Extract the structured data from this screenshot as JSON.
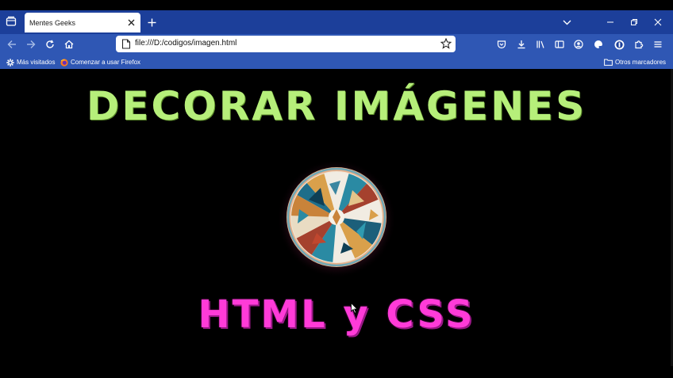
{
  "browser": {
    "tab": {
      "title": "Mentes Geeks"
    },
    "address": {
      "url": "file:///D:/codigos/imagen.html"
    },
    "bookmarks": [
      {
        "label": "Más visitados",
        "icon": "gear-icon"
      },
      {
        "label": "Comenzar a usar Firefox",
        "icon": "firefox-icon"
      },
      {
        "label": "Otros marcadores",
        "icon": "folder-icon"
      }
    ]
  },
  "page": {
    "title": "Decorar Imágenes",
    "subtitle": "HTML y CSS"
  },
  "colors": {
    "tabstrip": "#1c3f9a",
    "toolbar": "#2f57b4",
    "title": "#b6ef7a",
    "subtitle": "#ff3bd8",
    "background": "#000000"
  }
}
